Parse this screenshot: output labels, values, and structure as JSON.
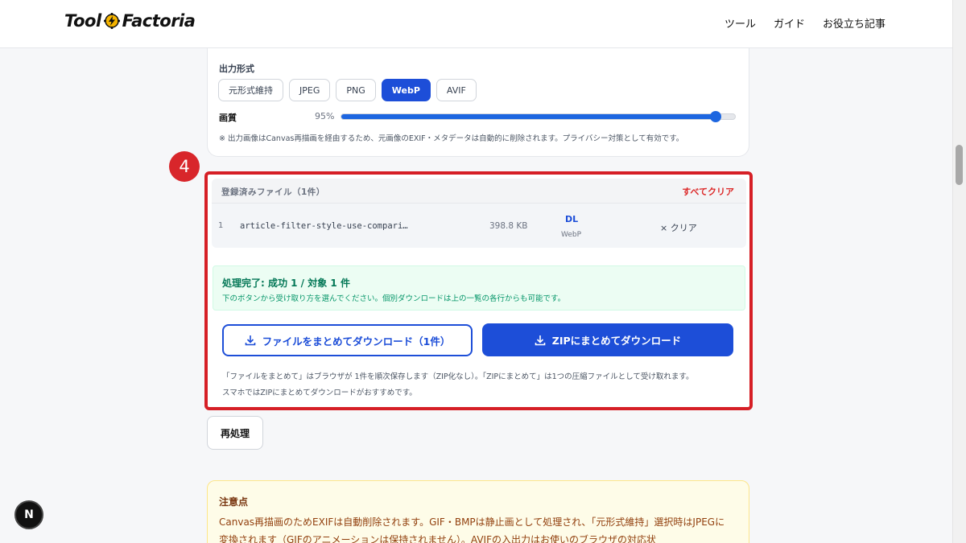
{
  "header": {
    "logo_left": "Tool",
    "logo_right": "Factoria",
    "nav": [
      "ツール",
      "ガイド",
      "お役立ち記事"
    ]
  },
  "output_settings": {
    "format_label": "出力形式",
    "formats": [
      "元形式維持",
      "JPEG",
      "PNG",
      "WebP",
      "AVIF"
    ],
    "selected_format": "WebP",
    "quality_label": "画質",
    "quality_value": "95%",
    "quality_fraction": 0.95,
    "privacy_note": "※ 出力画像はCanvas再描画を経由するため、元画像のEXIF・メタデータは自動的に削除されます。プライバシー対策として有効です。"
  },
  "step_marker": "4",
  "files": {
    "title": "登録済みファイル（1件）",
    "clear_all": "すべてクリア",
    "rows": [
      {
        "index": "1",
        "name": "article-filter-style-use-compari…",
        "size": "398.8 KB",
        "download": "DL",
        "format": "WebP",
        "clear": "× クリア"
      }
    ]
  },
  "result": {
    "title": "処理完了: 成功 1 / 対象 1 件",
    "subtitle": "下のボタンから受け取り方を選んでください。個別ダウンロードは上の一覧の各行からも可能です。",
    "btn_files": "ファイルをまとめてダウンロード（1件）",
    "btn_zip": "ZIPにまとめてダウンロード",
    "hint1": "「ファイルをまとめて」はブラウザが 1件を順次保存します（ZIP化なし）。「ZIPにまとめて」は1つの圧縮ファイルとして受け取れます。",
    "hint2": "スマホではZIPにまとめてダウンロードがおすすめです。"
  },
  "reprocess_label": "再処理",
  "caution": {
    "title": "注意点",
    "text": "Canvas再描画のためEXIFは自動削除されます。GIF・BMPは静止画として処理され、「元形式維持」選択時はJPEGに変換されます（GIFのアニメーションは保持されません）。AVIFの入出力はお使いのブラウザの対応状"
  },
  "badge": "N",
  "colors": {
    "accent": "#1d4ed8",
    "highlight": "#d61f26",
    "success": "#047857",
    "danger": "#dc2626"
  }
}
